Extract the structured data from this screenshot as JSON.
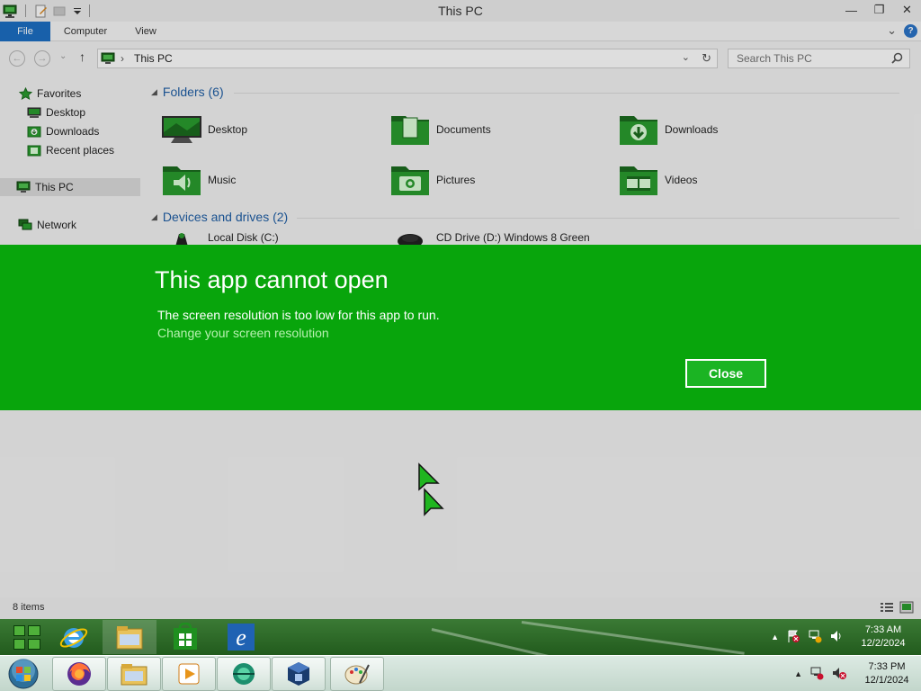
{
  "window": {
    "title": "This PC",
    "buttons": {
      "minimize": "—",
      "restore": "❐",
      "close": "✕"
    }
  },
  "ribbon": {
    "tabs": [
      "File",
      "Computer",
      "View"
    ],
    "expand_glyph": "⌄",
    "help_glyph": "?"
  },
  "navigation": {
    "back_glyph": "←",
    "forward_glyph": "→",
    "recent_glyph": "⌄",
    "up_glyph": "↑",
    "breadcrumb_sep": "›",
    "address": "This PC",
    "address_dropdown": "⌄",
    "refresh_glyph": "↻",
    "search_placeholder": "Search This PC"
  },
  "nav_pane": {
    "favorites": "Favorites",
    "items": [
      "Desktop",
      "Downloads",
      "Recent places"
    ],
    "this_pc": "This PC",
    "network": "Network"
  },
  "content": {
    "folders_header": "Folders (6)",
    "folders": [
      "Desktop",
      "Documents",
      "Downloads",
      "Music",
      "Pictures",
      "Videos"
    ],
    "devices_header": "Devices and drives (2)",
    "drives": [
      "Local Disk (C:)",
      "CD Drive (D:) Windows 8 Green"
    ]
  },
  "status": {
    "items": "8 items"
  },
  "dialog": {
    "title": "This app cannot open",
    "message": "The screen resolution is too low for this app to run.",
    "link": "Change your screen resolution",
    "close": "Close"
  },
  "taskbar_top": {
    "time": "7:33 AM",
    "date": "12/2/2024",
    "tray_arrow": "▲"
  },
  "taskbar_bottom": {
    "time": "7:33 PM",
    "date": "12/1/2024",
    "tray_arrow": "▲"
  },
  "colors": {
    "dialog_green": "#08a50c",
    "folder_green": "#2a9d2f",
    "file_tab_blue": "#1c6fc4"
  }
}
